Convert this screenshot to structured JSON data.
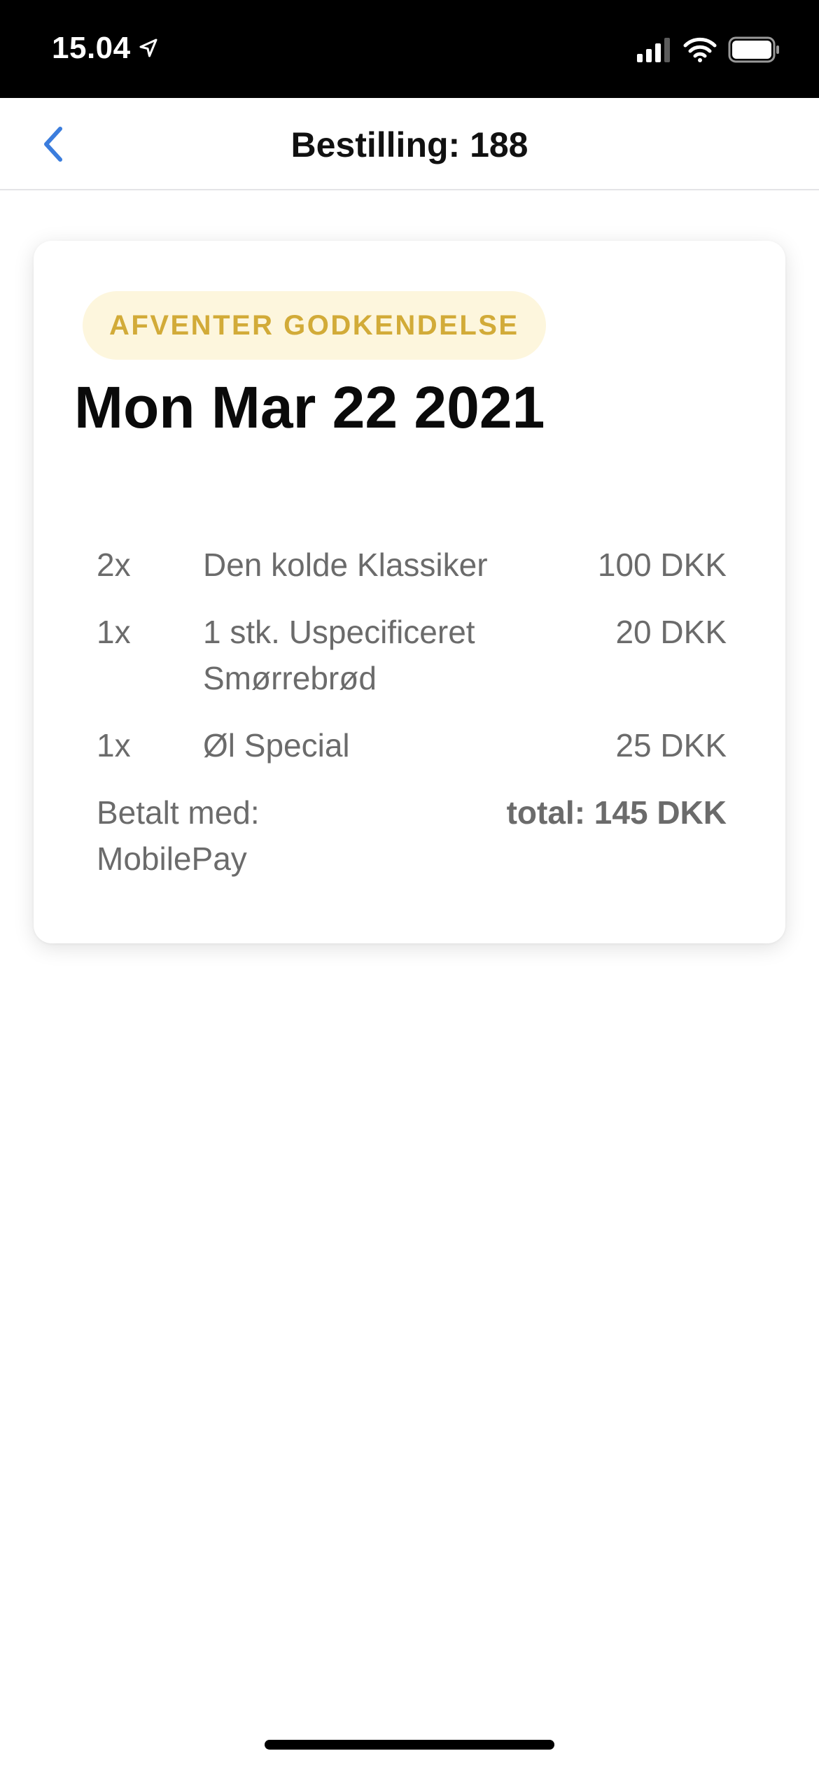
{
  "status_bar": {
    "time": "15.04",
    "icons": [
      "location-arrow-icon",
      "cellular-signal-icon",
      "wifi-icon",
      "battery-icon"
    ]
  },
  "nav": {
    "back_icon": "chevron-left-icon",
    "title": "Bestilling: 188"
  },
  "order": {
    "status": "AFVENTER GODKENDELSE",
    "date": "Mon Mar 22 2021",
    "items": [
      {
        "qty": "2x",
        "name": "Den kolde Klassiker",
        "price": "100 DKK"
      },
      {
        "qty": "1x",
        "name": "1 stk. Uspecificeret Smørrebrød",
        "price": "20 DKK"
      },
      {
        "qty": "1x",
        "name": "Øl Special",
        "price": "25 DKK"
      }
    ],
    "paid_with": "Betalt med: MobilePay",
    "total": "total: 145 DKK"
  },
  "colors": {
    "accent": "#3b7ddd",
    "badge_text": "#d2ab38",
    "badge_bg": "#fdf6dd",
    "secondary_text": "#6b6b6b"
  }
}
